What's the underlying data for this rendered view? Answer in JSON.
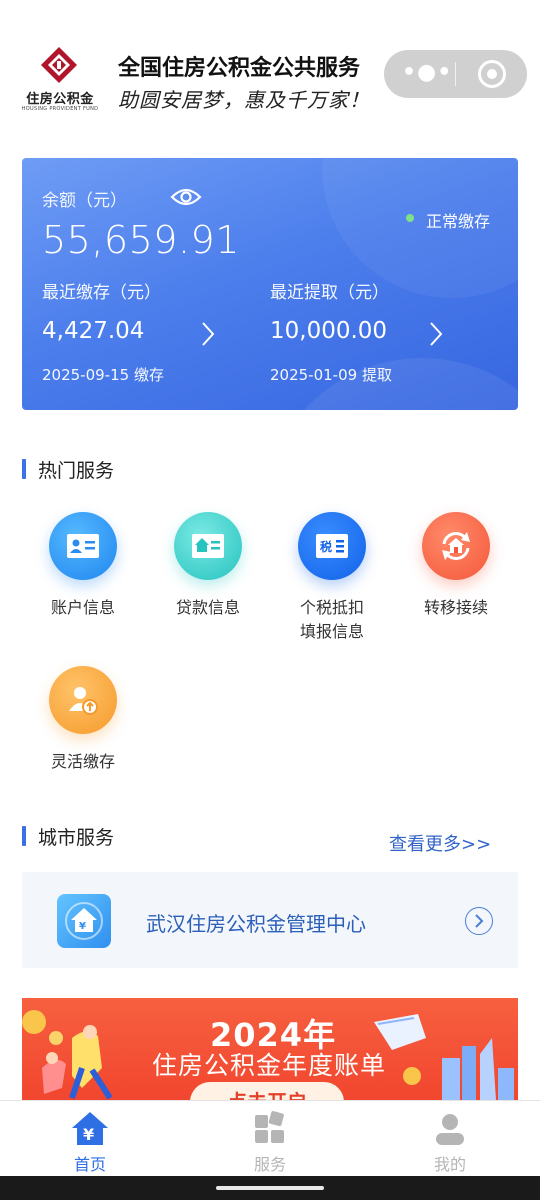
{
  "header": {
    "logo_text": "住房公积金",
    "logo_sub": "HOUSING PROVIDENT FUND",
    "title": "全国住房公积金公共服务",
    "slogan": "助圆安居梦，惠及千万家！",
    "capsule": {
      "menu_icon": "more-dots-icon",
      "close_icon": "target-icon"
    }
  },
  "balance_card": {
    "balance_label": "余额（元）",
    "balance_value": "55,659.91",
    "status": "正常缴存",
    "status_color": "#7fe28a",
    "deposit": {
      "label": "最近缴存（元）",
      "value": "4,427.04",
      "date": "2025-09-15 缴存"
    },
    "withdraw": {
      "label": "最近提取（元）",
      "value": "10,000.00",
      "date": "2025-01-09 提取"
    }
  },
  "hot_services": {
    "title": "热门服务",
    "items": [
      {
        "label": "账户信息",
        "icon": "account-card-icon"
      },
      {
        "label": "贷款信息",
        "icon": "loan-house-icon"
      },
      {
        "label_line1": "个税抵扣",
        "label_line2": "填报信息",
        "icon": "tax-icon"
      },
      {
        "label": "转移接续",
        "icon": "transfer-icon"
      },
      {
        "label": "灵活缴存",
        "icon": "flexible-deposit-icon"
      }
    ]
  },
  "city_services": {
    "title": "城市服务",
    "more": "查看更多>>",
    "items": [
      {
        "name": "武汉住房公积金管理中心",
        "icon": "city-center-icon"
      }
    ]
  },
  "banner": {
    "year": "2024年",
    "text": "住房公积金年度账单",
    "button": "点击开启"
  },
  "tabbar": {
    "active_color": "#2f6fe4",
    "inactive_color": "#b5b5b5",
    "tabs": [
      {
        "label": "首页",
        "icon": "home-yuan-icon",
        "active": true
      },
      {
        "label": "服务",
        "icon": "grid-icon",
        "active": false
      },
      {
        "label": "我的",
        "icon": "user-icon",
        "active": false
      }
    ]
  }
}
